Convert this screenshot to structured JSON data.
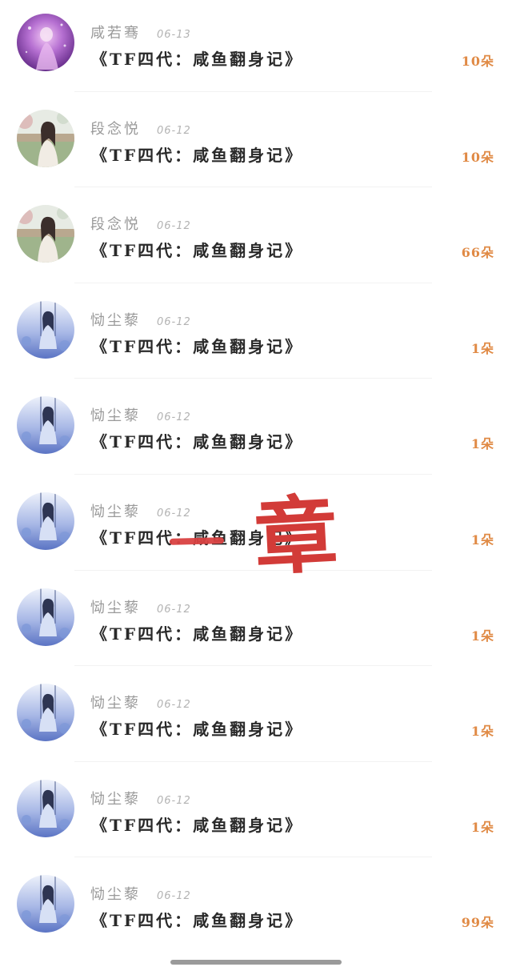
{
  "list": {
    "items": [
      {
        "name": "咸若骞",
        "date": "06-13",
        "title": "《TF四代：咸鱼翻身记》",
        "count": "10朵",
        "avatar": "purple-fantasy-avatar"
      },
      {
        "name": "段念悦",
        "date": "06-12",
        "title": "《TF四代：咸鱼翻身记》",
        "count": "10朵",
        "avatar": "garden-girl-avatar"
      },
      {
        "name": "段念悦",
        "date": "06-12",
        "title": "《TF四代：咸鱼翻身记》",
        "count": "66朵",
        "avatar": "garden-girl-avatar"
      },
      {
        "name": "恸尘藜",
        "date": "06-12",
        "title": "《TF四代：咸鱼翻身记》",
        "count": "1朵",
        "avatar": "blue-swing-girl-avatar"
      },
      {
        "name": "恸尘藜",
        "date": "06-12",
        "title": "《TF四代：咸鱼翻身记》",
        "count": "1朵",
        "avatar": "blue-swing-girl-avatar"
      },
      {
        "name": "恸尘藜",
        "date": "06-12",
        "title": "《TF四代：咸鱼翻身记》",
        "count": "1朵",
        "avatar": "blue-swing-girl-avatar"
      },
      {
        "name": "恸尘藜",
        "date": "06-12",
        "title": "《TF四代：咸鱼翻身记》",
        "count": "1朵",
        "avatar": "blue-swing-girl-avatar"
      },
      {
        "name": "恸尘藜",
        "date": "06-12",
        "title": "《TF四代：咸鱼翻身记》",
        "count": "1朵",
        "avatar": "blue-swing-girl-avatar"
      },
      {
        "name": "恸尘藜",
        "date": "06-12",
        "title": "《TF四代：咸鱼翻身记》",
        "count": "1朵",
        "avatar": "blue-swing-girl-avatar"
      },
      {
        "name": "恸尘藜",
        "date": "06-12",
        "title": "《TF四代：咸鱼翻身记》",
        "count": "99朵",
        "avatar": "blue-swing-girl-avatar"
      }
    ]
  },
  "overlay": {
    "handwritten_text": "一章",
    "strike_char": "一",
    "big_char": "章"
  },
  "colors": {
    "count_accent": "#e08a45",
    "overlay_red": "#d23b38",
    "name_gray": "#9a9a9a",
    "title_dark": "#2a2a2a"
  }
}
